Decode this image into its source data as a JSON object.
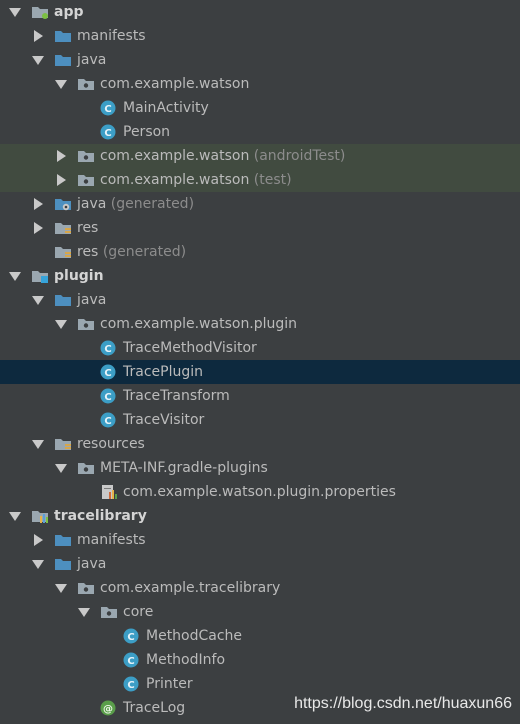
{
  "tree": [
    {
      "depth": 0,
      "state": "expanded",
      "icon": "module-android-icon",
      "label": "app",
      "bold": true
    },
    {
      "depth": 1,
      "state": "collapsed",
      "icon": "folder-icon",
      "label": "manifests"
    },
    {
      "depth": 1,
      "state": "expanded",
      "icon": "folder-icon",
      "label": "java"
    },
    {
      "depth": 2,
      "state": "expanded",
      "icon": "package-icon",
      "label": "com.example.watson"
    },
    {
      "depth": 3,
      "state": "leaf",
      "icon": "class-icon",
      "label": "MainActivity"
    },
    {
      "depth": 3,
      "state": "leaf",
      "icon": "class-icon",
      "label": "Person"
    },
    {
      "depth": 2,
      "state": "collapsed",
      "icon": "package-icon",
      "label": "com.example.watson",
      "suffix": "(androidTest)",
      "highlight": "green"
    },
    {
      "depth": 2,
      "state": "collapsed",
      "icon": "package-icon",
      "label": "com.example.watson",
      "suffix": "(test)",
      "highlight": "green"
    },
    {
      "depth": 1,
      "state": "collapsed",
      "icon": "generated-folder-icon",
      "label": "java",
      "suffix": "(generated)"
    },
    {
      "depth": 1,
      "state": "collapsed",
      "icon": "resource-folder-icon",
      "label": "res"
    },
    {
      "depth": 1,
      "state": "leaf",
      "icon": "resource-folder-icon",
      "label": "res",
      "suffix": "(generated)"
    },
    {
      "depth": 0,
      "state": "expanded",
      "icon": "module-plugin-icon",
      "label": "plugin",
      "bold": true
    },
    {
      "depth": 1,
      "state": "expanded",
      "icon": "folder-icon",
      "label": "java"
    },
    {
      "depth": 2,
      "state": "expanded",
      "icon": "package-icon",
      "label": "com.example.watson.plugin"
    },
    {
      "depth": 3,
      "state": "leaf",
      "icon": "class-icon",
      "label": "TraceMethodVisitor"
    },
    {
      "depth": 3,
      "state": "leaf",
      "icon": "class-icon",
      "label": "TracePlugin",
      "highlight": "selected"
    },
    {
      "depth": 3,
      "state": "leaf",
      "icon": "class-icon",
      "label": "TraceTransform"
    },
    {
      "depth": 3,
      "state": "leaf",
      "icon": "class-icon",
      "label": "TraceVisitor"
    },
    {
      "depth": 1,
      "state": "expanded",
      "icon": "resource-folder-icon",
      "label": "resources"
    },
    {
      "depth": 2,
      "state": "expanded",
      "icon": "package-icon",
      "label": "META-INF.gradle-plugins"
    },
    {
      "depth": 3,
      "state": "leaf",
      "icon": "properties-file-icon",
      "label": "com.example.watson.plugin.properties"
    },
    {
      "depth": 0,
      "state": "expanded",
      "icon": "module-library-icon",
      "label": "tracelibrary",
      "bold": true
    },
    {
      "depth": 1,
      "state": "collapsed",
      "icon": "folder-icon",
      "label": "manifests"
    },
    {
      "depth": 1,
      "state": "expanded",
      "icon": "folder-icon",
      "label": "java"
    },
    {
      "depth": 2,
      "state": "expanded",
      "icon": "package-icon",
      "label": "com.example.tracelibrary"
    },
    {
      "depth": 3,
      "state": "expanded",
      "icon": "package-icon",
      "label": "core"
    },
    {
      "depth": 4,
      "state": "leaf",
      "icon": "class-icon",
      "label": "MethodCache"
    },
    {
      "depth": 4,
      "state": "leaf",
      "icon": "class-icon",
      "label": "MethodInfo"
    },
    {
      "depth": 4,
      "state": "leaf",
      "icon": "class-icon",
      "label": "Printer"
    },
    {
      "depth": 3,
      "state": "leaf",
      "icon": "annotation-icon",
      "label": "TraceLog"
    }
  ],
  "watermark": "https://blog.csdn.net/huaxun66",
  "colors": {
    "background": "#3c3f41",
    "highlight_green": "#414b40",
    "selected": "#0d293e",
    "class_badge": "#3c9ec6",
    "annotation_badge": "#5a9e4a",
    "folder": "#4d8fbf",
    "package_folder": "#9aa7b0"
  }
}
